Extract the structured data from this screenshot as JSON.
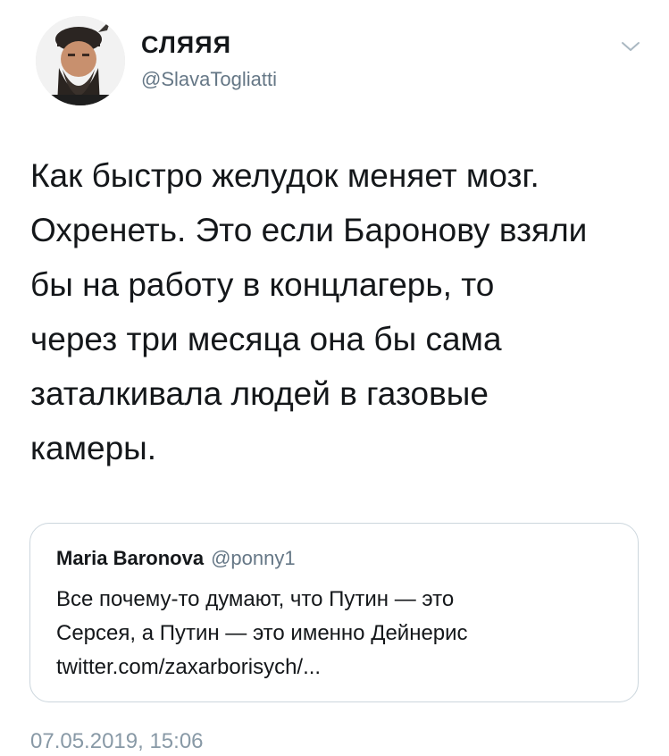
{
  "author": {
    "display_name": "СЛЯЯЯ",
    "handle": "@SlavaTogliatti"
  },
  "tweet": {
    "lines": [
      "Как быстро желудок меняет мозг.",
      "Охренеть. Это если Баронову взяли",
      "бы на работу в концлагерь, то",
      "через три месяца она бы сама",
      "заталкивала людей в газовые",
      "камеры."
    ],
    "timestamp": "07.05.2019, 15:06"
  },
  "quote": {
    "name": "Maria Baronova",
    "handle": "@ponny1",
    "lines": [
      "Все почему-то думают, что Путин — это",
      "Серсея, а Путин — это именно Дейнерис",
      "twitter.com/zaxarborisych/..."
    ]
  },
  "icons": {
    "caret": "chevron-down-icon",
    "avatar": "user-avatar"
  },
  "colors": {
    "text": "#14171a",
    "secondary": "#657786",
    "timestamp": "#8899a6",
    "border": "#ccd6dd"
  }
}
